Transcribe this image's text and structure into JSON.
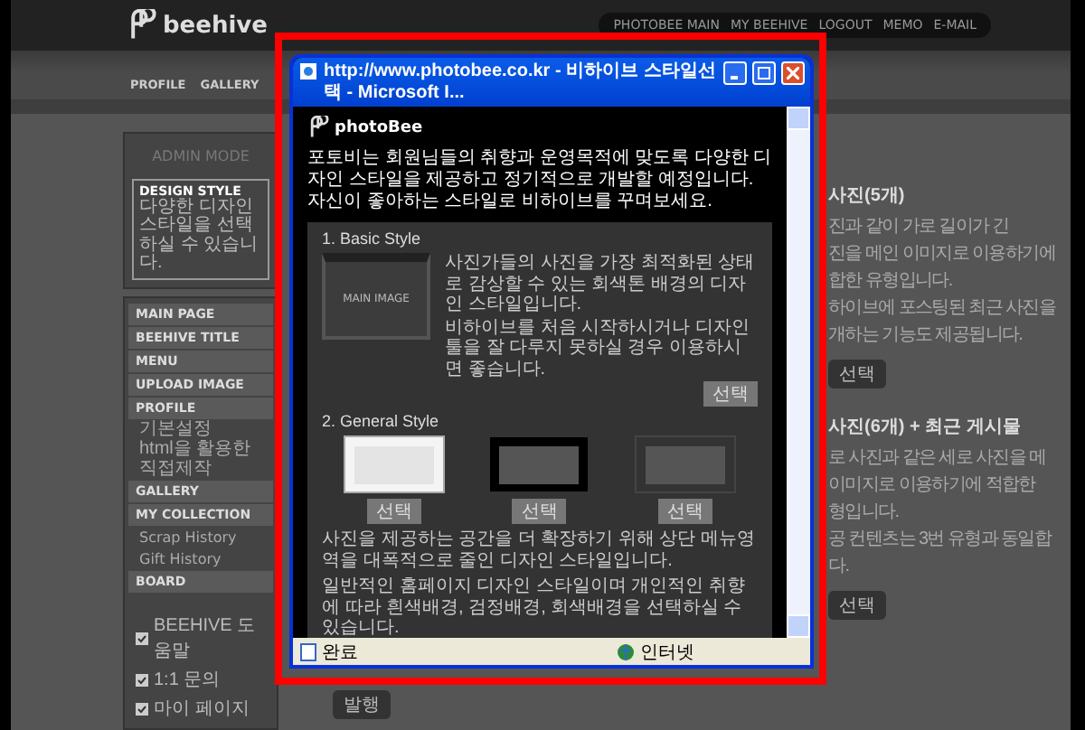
{
  "header": {
    "logo": "beehive",
    "top_links": [
      "PHOTOBEE MAIN",
      "MY BEEHIVE",
      "LOGOUT",
      "MEMO",
      "E-MAIL"
    ]
  },
  "nav": {
    "items": [
      "PROFILE",
      "GALLERY"
    ]
  },
  "sidebar": {
    "admin_title": "ADMIN MODE",
    "design_style": {
      "title": "DESIGN STYLE",
      "description": "다양한 디자인 스타일을 선택하실 수 있습니다."
    },
    "menu": [
      {
        "label": "MAIN PAGE"
      },
      {
        "label": "BEEHIVE TITLE"
      },
      {
        "label": "MENU"
      },
      {
        "label": "UPLOAD IMAGE"
      },
      {
        "label": "PROFILE",
        "children": [
          "기본설정",
          "html을 활용한 직접제작"
        ]
      },
      {
        "label": "GALLERY"
      },
      {
        "label": "MY COLLECTION",
        "children": [
          "Scrap History",
          "Gift History"
        ]
      },
      {
        "label": "BOARD"
      }
    ],
    "links": [
      "BEEHIVE 도움말",
      "1:1 문의",
      "마이 페이지"
    ]
  },
  "background_panel": {
    "sections": [
      {
        "title": "사진(5개)",
        "lines": [
          "진과 같이 가로 길이가 긴",
          "진을 메인 이미지로 이용하기에",
          "합한 유형입니다.",
          "하이브에 포스팅된 최근 사진을",
          "개하는 기능도 제공됩니다."
        ],
        "button": "선택"
      },
      {
        "title": "사진(6개) + 최근 게시물",
        "lines": [
          "로 사진과 같은 세로 사진을 메",
          "이미지로 이용하기에 적합한",
          "형입니다.",
          "공 컨텐츠는 3번 유형과 동일합",
          "다."
        ],
        "button": "선택"
      }
    ],
    "footer_button": "발행"
  },
  "popup": {
    "title": "http://www.photobee.co.kr - 비하이브 스타일선택 - Microsoft I...",
    "logo": "photoBee",
    "intro": "포토비는 회원님들의 취향과 운영목적에 맞도록 다양한 디자인 스타일을 제공하고 정기적으로 개발할 예정입니다. 자신이 좋아하는 스타일로 비하이브를 꾸며보세요.",
    "sections": [
      {
        "kind": "basic",
        "heading": "1. Basic Style",
        "thumbnail_label": "MAIN IMAGE",
        "paragraphs": [
          "사진가들의 사진을 가장 최적화된 상태로 감상할 수 있는 회색톤 배경의 디자인 스타일입니다.",
          "비하이브를 처음 시작하시거나 디자인 툴을 잘 다루지 못하실 경우 이용하시면 좋습니다."
        ],
        "button": "선택"
      },
      {
        "kind": "general",
        "heading": "2. General Style",
        "options": [
          {
            "kind": "light",
            "button": "선택"
          },
          {
            "kind": "dark",
            "button": "선택"
          },
          {
            "kind": "gray",
            "button": "선택"
          }
        ],
        "paragraphs": [
          "사진을 제공하는 공간을 더 확장하기 위해 상단 메뉴영역을 대폭적으로 줄인 디자인 스타일입니다.",
          "일반적인 홈페이지 디자인 스타일이며 개인적인 취향에 따라 흰색배경, 검정배경, 회색배경을 선택하실 수 있습니다."
        ]
      }
    ],
    "status": {
      "text": "완료",
      "zone": "인터넷"
    }
  }
}
